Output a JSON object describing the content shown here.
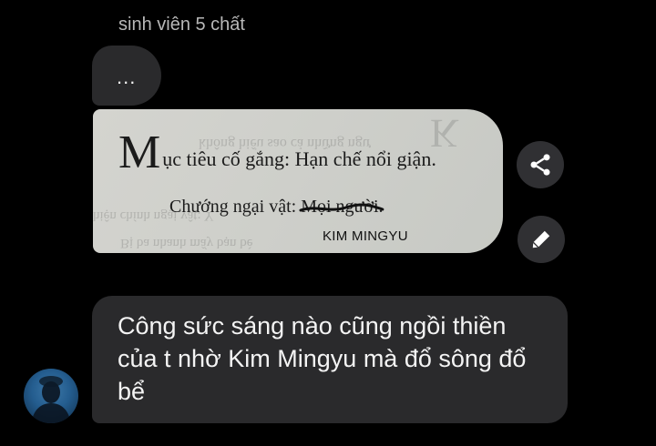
{
  "chat": {
    "sender_name": "sinh viên 5 chất",
    "messages": {
      "dots": "...",
      "photo": {
        "line1_dropcap": "M",
        "line1_rest": "ục tiêu cố gắng: Hạn chế nổi giận.",
        "line2_prefix": "Chướng ngại vật: ",
        "line2_struck": "Mọi người",
        "line2_suffix": ".",
        "handwritten_note": "KIM MINGYU"
      },
      "text": "Công sức sáng nào cũng ngồi thiền của t nhờ Kim Mingyu mà đổ sông đổ bể"
    },
    "actions": {
      "share_icon": "share-icon",
      "edit_icon": "pencil-icon"
    }
  },
  "colors": {
    "background": "#000000",
    "bubble": "#2a2a2c",
    "action_button": "#303033",
    "sender_text": "#b8b8b8",
    "message_text": "#f4f4f4"
  }
}
